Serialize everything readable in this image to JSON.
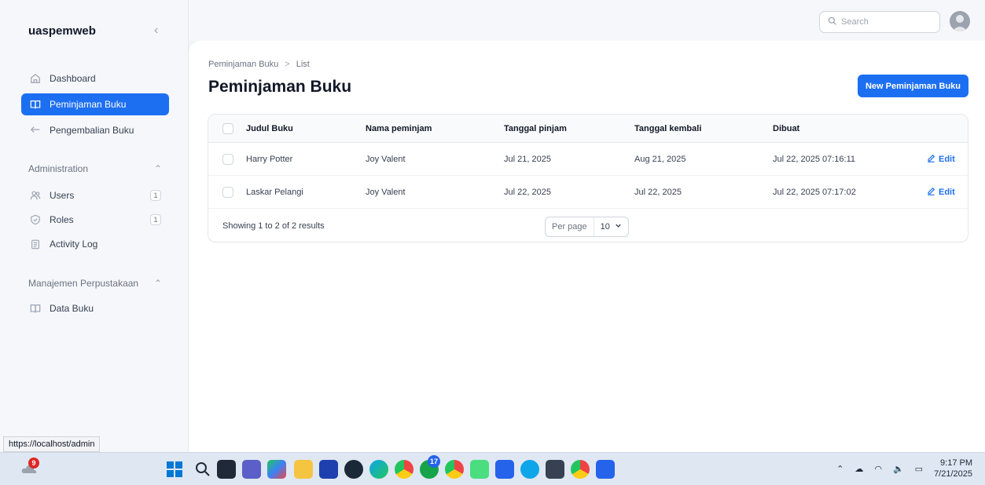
{
  "app": {
    "brand": "uaspemweb"
  },
  "sidebar": {
    "items": [
      {
        "label": "Dashboard",
        "icon": "home-icon"
      },
      {
        "label": "Peminjaman Buku",
        "icon": "book-open-icon",
        "active": true
      },
      {
        "label": "Pengembalian Buku",
        "icon": "return-arrow-icon"
      }
    ],
    "groups": [
      {
        "label": "Administration",
        "items": [
          {
            "label": "Users",
            "badge": "1"
          },
          {
            "label": "Roles",
            "badge": "1"
          },
          {
            "label": "Activity Log"
          }
        ]
      },
      {
        "label": "Manajemen Perpustakaan",
        "items": [
          {
            "label": "Data Buku"
          }
        ]
      }
    ]
  },
  "topbar": {
    "search_placeholder": "Search"
  },
  "main": {
    "breadcrumb": [
      "Peminjaman Buku",
      ">",
      "List"
    ],
    "title": "Peminjaman Buku",
    "new_button": "New Peminjaman Buku",
    "table": {
      "columns": [
        "Judul Buku",
        "Nama peminjam",
        "Tanggal pinjam",
        "Tanggal kembali",
        "Dibuat"
      ],
      "rows": [
        [
          "Harry Potter",
          "Joy Valent",
          "Jul 21, 2025",
          "Aug 21, 2025",
          "Jul 22, 2025 07:16:11"
        ],
        [
          "Laskar Pelangi",
          "Joy Valent",
          "Jul 22, 2025",
          "Jul 22, 2025",
          "Jul 22, 2025 07:17:02"
        ]
      ],
      "edit_label": "Edit",
      "showing": "Showing 1 to 2 of 2 results",
      "per_page_label": "Per page",
      "per_page_value": "10"
    }
  },
  "status_url": "https://localhost/admin",
  "taskbar": {
    "notification_count": "9",
    "time": "9:17 PM",
    "date": "7/21/2025",
    "chrome_badge": "17"
  },
  "colors": {
    "accent": "#1d6ff2",
    "sidebar_bg": "#f5f7fb"
  }
}
